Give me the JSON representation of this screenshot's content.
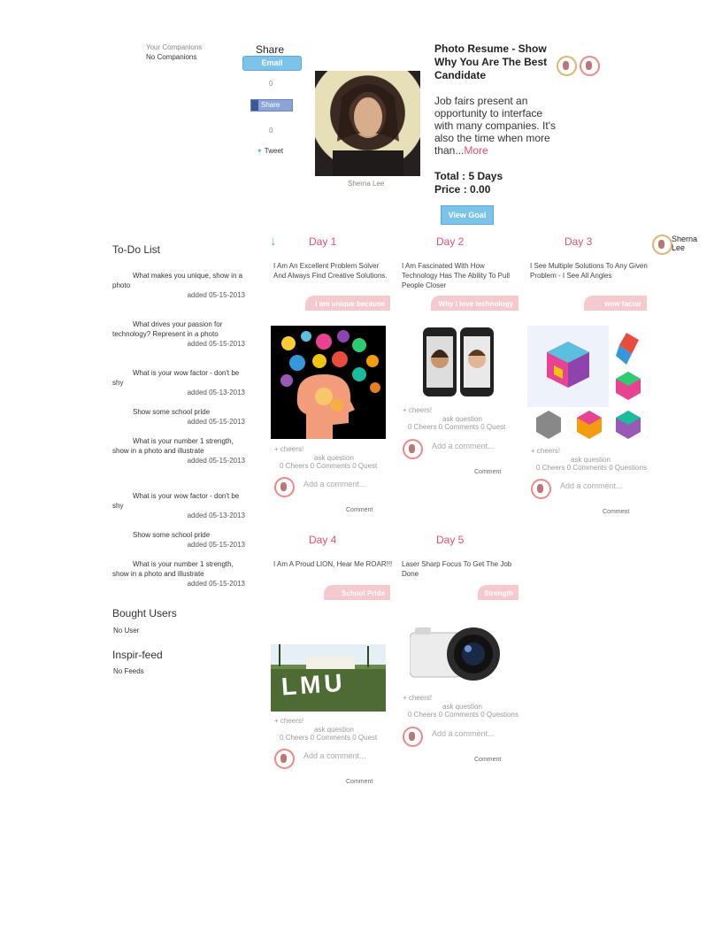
{
  "companions": {
    "label": "Your Companions",
    "value": "No Companions"
  },
  "share": {
    "title": "Share",
    "email": "Email",
    "count1": "0",
    "fb": "Share",
    "count2": "0",
    "tweet": "Tweet"
  },
  "profile": {
    "name": "Sherna Lee"
  },
  "goal": {
    "title": "Photo Resume - Show Why You Are The Best Candidate",
    "desc": "Job fairs present an opportunity to interface with many companies. It's also the time when more than...",
    "more": "More",
    "total": "Total : 5 Days",
    "price": "Price : 0.00",
    "view_btn": "View Goal"
  },
  "user_badge": "Sherna Lee",
  "todo": {
    "title": "To-Do List",
    "items": [
      {
        "q": "What makes you unique, show in a photo",
        "d": "added 05-15-2013"
      },
      {
        "q": "What drives your passion for technology? Represent in a photo",
        "d": "added 05-15-2013"
      },
      {
        "q": "What is your wow factor - don't be shy",
        "d": "added 05-13-2013"
      },
      {
        "q": "Show some school pride",
        "d": "added 05-15-2013"
      },
      {
        "q": "What is your number 1 strength, show in a photo and illustrate",
        "d": "added 05-15-2013"
      },
      {
        "q": "What is your wow factor - don't be shy",
        "d": "added 05-13-2013"
      },
      {
        "q": "Show some school pride",
        "d": "added 05-15-2013"
      },
      {
        "q": "What is your number 1 strength, show in a photo and illustrate",
        "d": "added 05-15-2013"
      }
    ]
  },
  "bought": {
    "title": "Bought Users",
    "value": "No User"
  },
  "feed": {
    "title": "Inspir-feed",
    "value": "No Feeds"
  },
  "days": [
    {
      "title": "Day 1",
      "desc": "I Am An Excellent Problem Solver And Always Find Creative Solutions.",
      "tag": "I am unique because",
      "cheers": "+ cheers!",
      "ask": "ask question",
      "stats": "0 Cheers 0 Comments 0 Quest",
      "add": "Add a comment...",
      "comment": "Comment"
    },
    {
      "title": "Day 2",
      "desc": "I Am Fascinated With How Technology Has The Ability To Pull People Closer",
      "tag": "Why I love technology",
      "cheers": "+ cheers!",
      "ask": "ask question",
      "stats": "0 Cheers 0 Comments 0 Quest",
      "add": "Add a comment...",
      "comment": "Comment"
    },
    {
      "title": "Day 3",
      "desc": "I See Multiple Solutions To Any Given Problem - I See All Angles",
      "tag": "wow factor",
      "cheers": "+ cheers!",
      "ask": "ask question",
      "stats": "0 Cheers 0 Comments 0 Questions",
      "add": "Add a comment...",
      "comment": "Comment"
    },
    {
      "title": "Day 4",
      "desc": "I Am A Proud LION, Hear Me ROAR!!!",
      "tag": "School Pride",
      "cheers": "+ cheers!",
      "ask": "ask question",
      "stats": "0 Cheers 0 Comments 0 Quest",
      "add": "Add a comment...",
      "comment": "Comment",
      "photo_text": "LMU"
    },
    {
      "title": "Day 5",
      "desc": "Laser Sharp Focus To Get The Job Done",
      "tag": "Strength",
      "cheers": "+ cheers!",
      "ask": "ask question",
      "stats": "0 Cheers 0 Comments 0 Questions",
      "add": "Add a comment...",
      "comment": "Comment"
    }
  ],
  "colors": {
    "accent": "#e0506b",
    "button": "#7cc3ea",
    "tag": "#f6c9cf"
  }
}
